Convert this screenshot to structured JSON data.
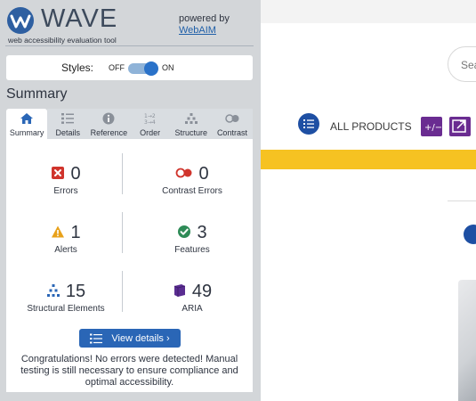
{
  "brand": {
    "title": "WAVE",
    "subtitle": "web accessibility evaluation tool",
    "powered_by": "powered by",
    "webaim_link": "WebAIM"
  },
  "styles": {
    "label": "Styles:",
    "off_label": "OFF",
    "on_label": "ON",
    "state": "on"
  },
  "summary": {
    "heading": "Summary",
    "tabs": [
      {
        "label": "Summary",
        "icon": "home-icon",
        "active": true
      },
      {
        "label": "Details",
        "icon": "list-icon"
      },
      {
        "label": "Reference",
        "icon": "info-icon"
      },
      {
        "label": "Order",
        "icon": "order-icon"
      },
      {
        "label": "Structure",
        "icon": "structure-icon"
      },
      {
        "label": "Contrast",
        "icon": "contrast-icon"
      }
    ],
    "stats": {
      "errors": {
        "count": "0",
        "label": "Errors"
      },
      "contrast_errors": {
        "count": "0",
        "label": "Contrast Errors"
      },
      "alerts": {
        "count": "1",
        "label": "Alerts"
      },
      "features": {
        "count": "3",
        "label": "Features"
      },
      "structural": {
        "count": "15",
        "label": "Structural Elements"
      },
      "aria": {
        "count": "49",
        "label": "ARIA"
      }
    },
    "view_details": "View details ›",
    "congrats": "Congratulations! No errors were detected! Manual testing is still necessary to ensure compliance and optimal accessibility."
  },
  "site": {
    "search_placeholder": "Sea",
    "all_products": "ALL PRODUCTS"
  },
  "colors": {
    "sidebar_bg": "#d3d6d9",
    "accent_blue": "#2a66b6",
    "error_red": "#d0342c",
    "alert_orange": "#e8a11a",
    "feature_green": "#2e8b57",
    "aria_purple": "#5a2d91",
    "site_yellow": "#f6c222"
  }
}
